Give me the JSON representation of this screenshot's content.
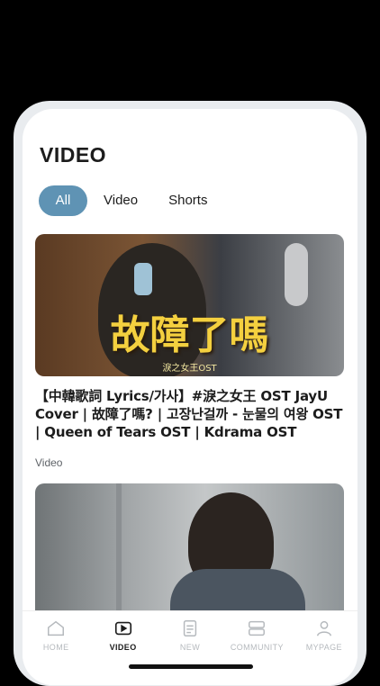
{
  "page": {
    "title": "VIDEO"
  },
  "tabs": [
    {
      "label": "All",
      "active": true
    },
    {
      "label": "Video",
      "active": false
    },
    {
      "label": "Shorts",
      "active": false
    }
  ],
  "videos": [
    {
      "thumbnail_text": "故障了嗎",
      "thumbnail_subtext": "淚之女王OST",
      "title": "【中韓歌詞 Lyrics/가사】#淚之女王 OST JayU Cover | 故障了嗎? | 고장난걸까 - 눈물의 여왕 OST | Queen of Tears OST | Kdrama OST",
      "category": "Video"
    },
    {
      "thumbnail_text": "",
      "title": "",
      "category": ""
    }
  ],
  "bottom_nav": [
    {
      "label": "HOME",
      "icon": "home-icon",
      "active": false
    },
    {
      "label": "VIDEO",
      "icon": "video-icon",
      "active": true
    },
    {
      "label": "NEW",
      "icon": "document-icon",
      "active": false
    },
    {
      "label": "COMMUNITY",
      "icon": "community-icon",
      "active": false
    },
    {
      "label": "MYPAGE",
      "icon": "person-icon",
      "active": false
    }
  ],
  "colors": {
    "accent": "#5f93b4",
    "inactive_nav": "#b5b9bd"
  }
}
